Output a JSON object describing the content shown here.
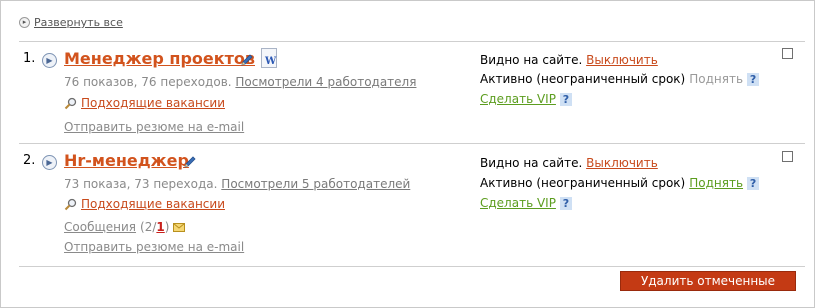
{
  "expand_all": "Развернуть все",
  "resumes": [
    {
      "number": "1.",
      "title": "Менеджер проектов",
      "views": "76 показов, 76 переходов.",
      "viewed_by": "Посмотрели 4 работодателя",
      "suitable": "Подходящие вакансии",
      "send": "Отправить резюме на e-mail",
      "visible_label": "Видно на сайте.",
      "visible_action": "Выключить",
      "active_label": "Активно (неограниченный срок)",
      "raise": "Поднять",
      "vip": "Сделать VIP",
      "help": "?"
    },
    {
      "number": "2.",
      "title": "Hr-менеджер",
      "views": "73 показа, 73 перехода.",
      "viewed_by": "Посмотрели 5 работодателей",
      "suitable": "Подходящие вакансии",
      "messages_label": "Сообщения",
      "messages_open": "(2/",
      "messages_new": "1",
      "messages_close": ")",
      "send": "Отправить резюме на e-mail",
      "visible_label": "Видно на сайте.",
      "visible_action": "Выключить",
      "active_label": "Активно (неограниченный срок)",
      "raise": "Поднять",
      "vip": "Сделать VIP",
      "help": "?"
    }
  ],
  "delete_button": "Удалить отмеченные",
  "colors": {
    "accent": "#d2531d",
    "green": "#5c9d1f",
    "button": "#c43a14"
  }
}
